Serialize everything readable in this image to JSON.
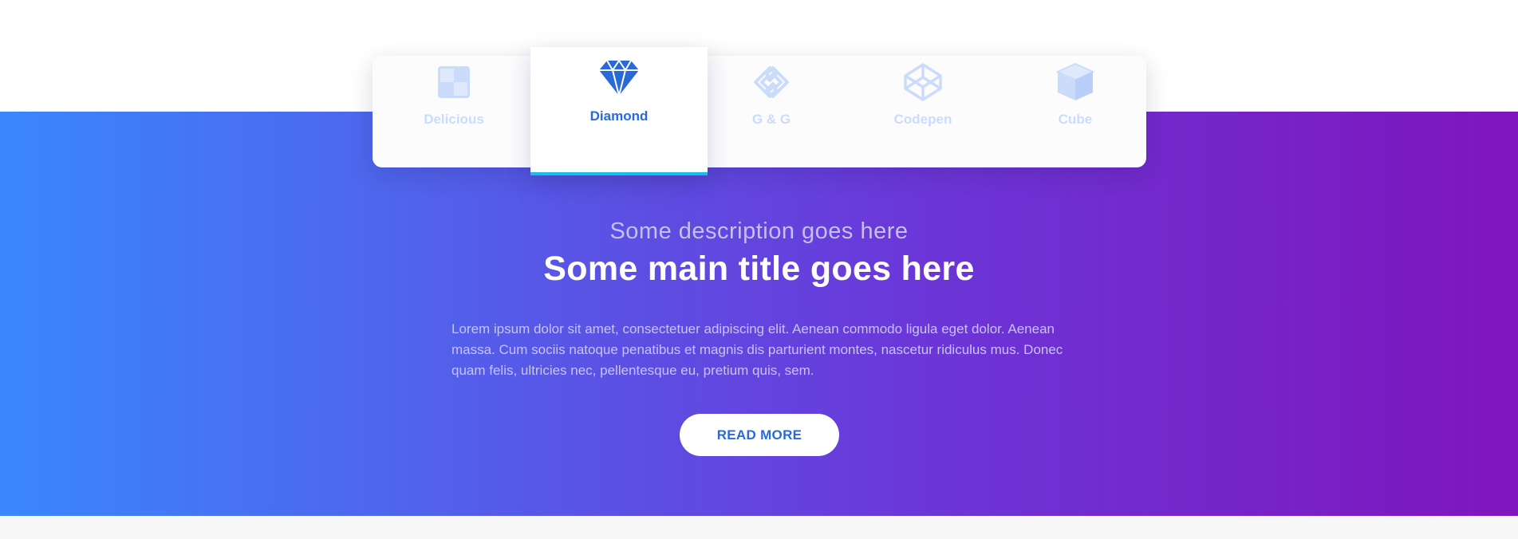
{
  "colors": {
    "gradient_start": "#3a87fc",
    "gradient_mid": "#6b37d8",
    "gradient_end": "#7f15bd",
    "active_tab_text": "#2a6ad8",
    "active_tab_underline": "#17c0e3",
    "inactive_tab": "#cbdcfb"
  },
  "tabs": [
    {
      "label": "Delicious",
      "icon": "delicious-icon",
      "active": false
    },
    {
      "label": "Diamond",
      "icon": "diamond-icon",
      "active": true
    },
    {
      "label": "G & G",
      "icon": "link-icon",
      "active": false
    },
    {
      "label": "Codepen",
      "icon": "codepen-icon",
      "active": false
    },
    {
      "label": "Cube",
      "icon": "cube-icon",
      "active": false
    }
  ],
  "content": {
    "subtitle": "Some description goes here",
    "title": "Some main title goes here",
    "body": "Lorem ipsum dolor sit amet, consectetuer adipiscing elit. Aenean commodo ligula eget dolor. Aenean massa. Cum sociis natoque penatibus et magnis dis parturient montes, nascetur ridiculus mus. Donec quam felis, ultricies nec, pellentesque eu, pretium quis, sem.",
    "button_label": "READ MORE"
  }
}
